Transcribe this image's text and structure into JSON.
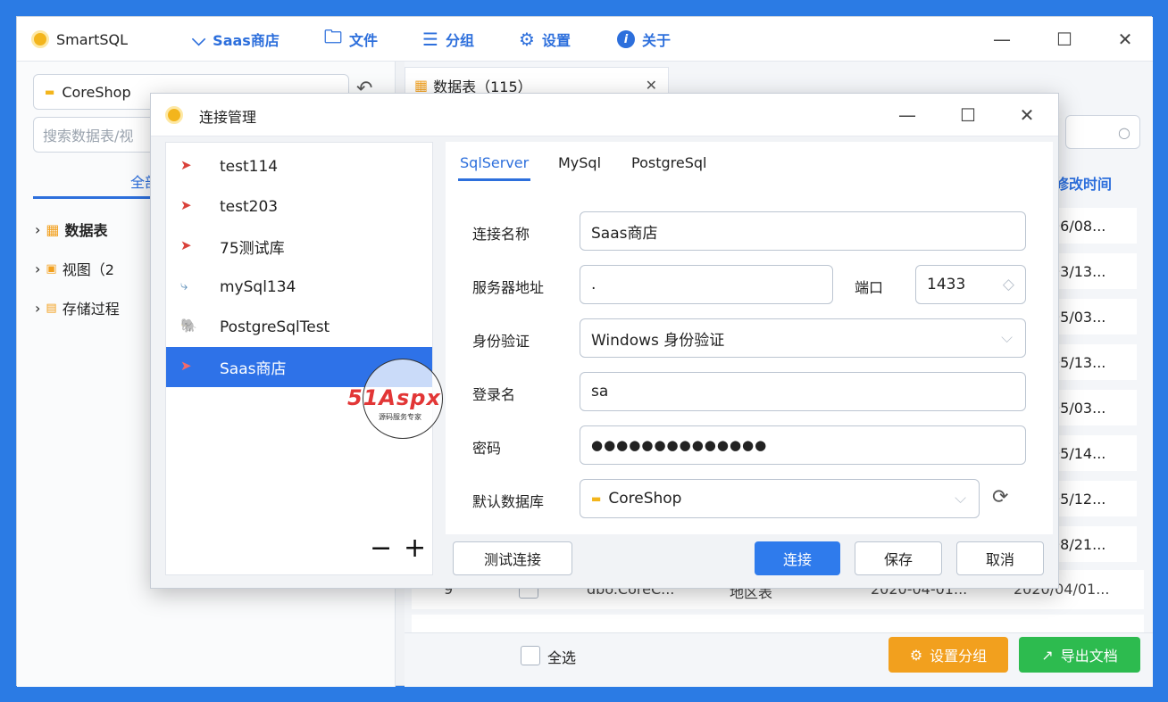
{
  "app": {
    "title": "SmartSQL"
  },
  "toolbar": {
    "connection_label": "Saas商店",
    "file_label": "文件",
    "group_label": "分组",
    "settings_label": "设置",
    "about_label": "关于"
  },
  "left": {
    "db_select": "CoreShop",
    "search_placeholder": "搜索数据表/视",
    "tab_all": "全部",
    "tree": [
      {
        "label": "数据表"
      },
      {
        "label": "视图（2"
      },
      {
        "label": "存储过程"
      }
    ]
  },
  "right": {
    "tab_label": "数据表（115）",
    "col_modified": "修改时间",
    "dates": [
      "06/08...",
      "03/13...",
      "05/03...",
      "05/13...",
      "05/03...",
      "05/14...",
      "05/12...",
      "08/21...",
      "2020/04/01..."
    ],
    "row9": {
      "num": "9",
      "name": "dbo.CoreC...",
      "desc": "地区表",
      "created": "2020-04-01...",
      "modified": "2020/04/01..."
    },
    "select_all": "全选",
    "set_group_button": "设置分组",
    "export_button": "导出文档"
  },
  "dialog": {
    "title": "连接管理",
    "connections": [
      {
        "name": "test114",
        "icon": "sqlserver-icon"
      },
      {
        "name": "test203",
        "icon": "sqlserver-icon"
      },
      {
        "name": "75测试库",
        "icon": "sqlserver-icon"
      },
      {
        "name": "mySql134",
        "icon": "mysql-icon"
      },
      {
        "name": "PostgreSqlTest",
        "icon": "postgresql-icon"
      },
      {
        "name": "Saas商店",
        "icon": "sqlserver-icon",
        "selected": true
      }
    ],
    "watermark": {
      "brand": "51Aspx",
      "sub": "源码服务专家"
    },
    "tabs": [
      "SqlServer",
      "MySql",
      "PostgreSql"
    ],
    "active_tab": "SqlServer",
    "fields": {
      "name_label": "连接名称",
      "name_value": "Saas商店",
      "server_label": "服务器地址",
      "server_value": ".",
      "port_label": "端口",
      "port_value": "1433",
      "auth_label": "身份验证",
      "auth_value": "Windows 身份验证",
      "login_label": "登录名",
      "login_value": "sa",
      "password_label": "密码",
      "password_value": "●●●●●●●●●●●●●●",
      "db_label": "默认数据库",
      "db_value": "CoreShop"
    },
    "buttons": {
      "test": "测试连接",
      "connect": "连接",
      "save": "保存",
      "cancel": "取消"
    }
  },
  "colors": {
    "accent": "#2d6fdc",
    "primary_button": "#2f7bec",
    "orange": "#f2a01e",
    "green": "#2dbb4f",
    "selected_row": "#2e72e8"
  }
}
